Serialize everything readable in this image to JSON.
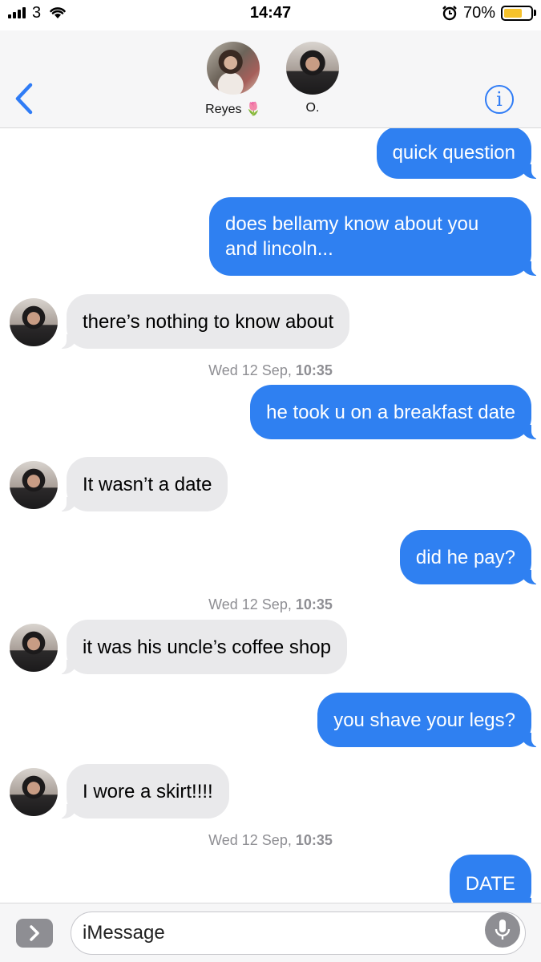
{
  "status_bar": {
    "carrier": "3",
    "time": "14:47",
    "battery_percent": "70%",
    "battery_level": 0.7,
    "icons": [
      "signal-icon",
      "wifi-icon",
      "alarm-icon",
      "battery-icon"
    ]
  },
  "header": {
    "contacts": [
      {
        "name": "Reyes 🌷",
        "avatar": "avatar-reyes"
      },
      {
        "name": "O.",
        "avatar": "avatar-o"
      }
    ],
    "back_icon": "chevron-left-icon",
    "info_icon": "i",
    "accent_color": "#2f7cf6"
  },
  "colors": {
    "outgoing_bubble": "#2f80f1",
    "incoming_bubble": "#e9e9eb",
    "timestamp": "#8e8e93"
  },
  "messages": [
    {
      "type": "out",
      "text": "quick question"
    },
    {
      "type": "out",
      "text": "does bellamy know about you and lincoln..."
    },
    {
      "type": "in",
      "text": "there’s nothing to know about"
    },
    {
      "type": "timestamp",
      "day": "Wed 12 Sep,",
      "time": "10:35"
    },
    {
      "type": "out",
      "text": "he took u on a breakfast date"
    },
    {
      "type": "in",
      "text": "It wasn’t a date"
    },
    {
      "type": "out",
      "text": "did he pay?"
    },
    {
      "type": "timestamp",
      "day": "Wed 12 Sep,",
      "time": "10:35"
    },
    {
      "type": "in",
      "text": "it was his uncle’s coffee shop"
    },
    {
      "type": "out",
      "text": "you shave your legs?"
    },
    {
      "type": "in",
      "text": "I wore a skirt!!!!"
    },
    {
      "type": "timestamp",
      "day": "Wed 12 Sep,",
      "time": "10:35"
    },
    {
      "type": "out",
      "text": "DATE"
    }
  ],
  "input": {
    "placeholder": "iMessage",
    "apps_icon": "chevron-right-icon",
    "mic_icon": "microphone-icon"
  }
}
